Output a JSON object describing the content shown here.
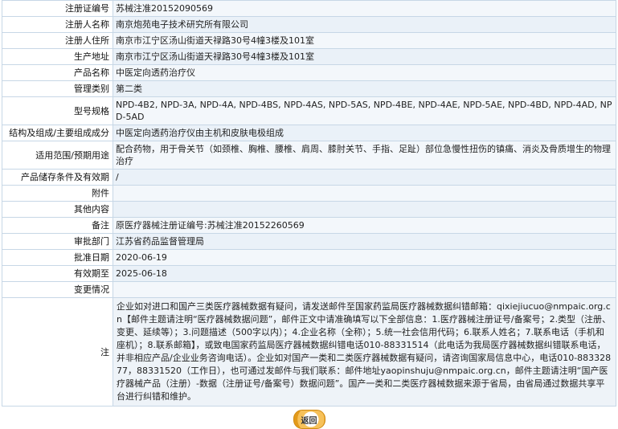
{
  "rows": [
    {
      "label": "注册证编号",
      "value": "苏械注准20152090569"
    },
    {
      "label": "注册人名称",
      "value": "南京炮苑电子技术研究所有限公司"
    },
    {
      "label": "注册人住所",
      "value": "南京市江宁区汤山街道天禄路30号4幢3楼及101室"
    },
    {
      "label": "生产地址",
      "value": "南京市江宁区汤山街道天禄路30号4幢3楼及101室"
    },
    {
      "label": "产品名称",
      "value": "中医定向透药治疗仪"
    },
    {
      "label": "管理类别",
      "value": "第二类"
    },
    {
      "label": "型号规格",
      "value": "NPD-4B2, NPD-3A, NPD-4A, NPD-4BS, NPD-4AS, NPD-5AS, NPD-4BE, NPD-4AE, NPD-5AE, NPD-4BD, NPD-4AD, NPD-5AD"
    },
    {
      "label": "结构及组成/主要组成成分",
      "value": "中医定向透药治疗仪由主机和皮肤电极组成"
    },
    {
      "label": "适用范围/预期用途",
      "value": "配合药物，用于骨关节（如颈椎、胸椎、腰椎、肩周、膝肘关节、手指、足趾）部位急慢性扭伤的镇痛、消炎及骨质增生的物理治疗"
    },
    {
      "label": "产品储存条件及有效期",
      "value": "/"
    },
    {
      "label": "附件",
      "value": ""
    },
    {
      "label": "其他内容",
      "value": ""
    },
    {
      "label": "备注",
      "value": "原医疗器械注册证编号:苏械注准20152260569"
    },
    {
      "label": "审批部门",
      "value": "江苏省药品监督管理局"
    },
    {
      "label": "批准日期",
      "value": "2020-06-19"
    },
    {
      "label": "有效期至",
      "value": "2025-06-18"
    },
    {
      "label": "变更情况",
      "value": ""
    }
  ],
  "notice": {
    "label": "注",
    "text": "企业如对进口和国产三类医疗器械数据有疑问，请发送邮件至国家药监局医疗器械数据纠错邮箱：qixiejiucuo@nmpaic.org.cn【邮件主题请注明“医疗器械数据问题”，邮件正文中请准确填写以下全部信息：1.医疗器械注册证号/备案号；2.类型（注册、变更、延续等）；3.问题描述（500字以内）；4.企业名称（全称）；5.统一社会信用代码；6.联系人姓名；7.联系电话（手机和座机）；8.联系邮箱】，或致电国家药监局医疗器械数据纠错电话010-88331514（此电话为我局医疗器械数据纠错联系电话，并非相应产品/企业业务咨询电话）。企业如对国产一类和二类医疗器械数据有疑问，请咨询国家局信息中心，电话010-88332877，88331520（工作日），也可通过发邮件与我们联系：邮件地址yaopinshuju@nmpaic.org.cn，邮件主题请注明“国产医疗器械产品（注册）-数据（注册证号/备案号）数据问题”。国产一类和二类医疗器械数据来源于省局，由省局通过数据共享平台进行纠错和维护。"
  },
  "footer": {
    "back_label": "返回"
  }
}
